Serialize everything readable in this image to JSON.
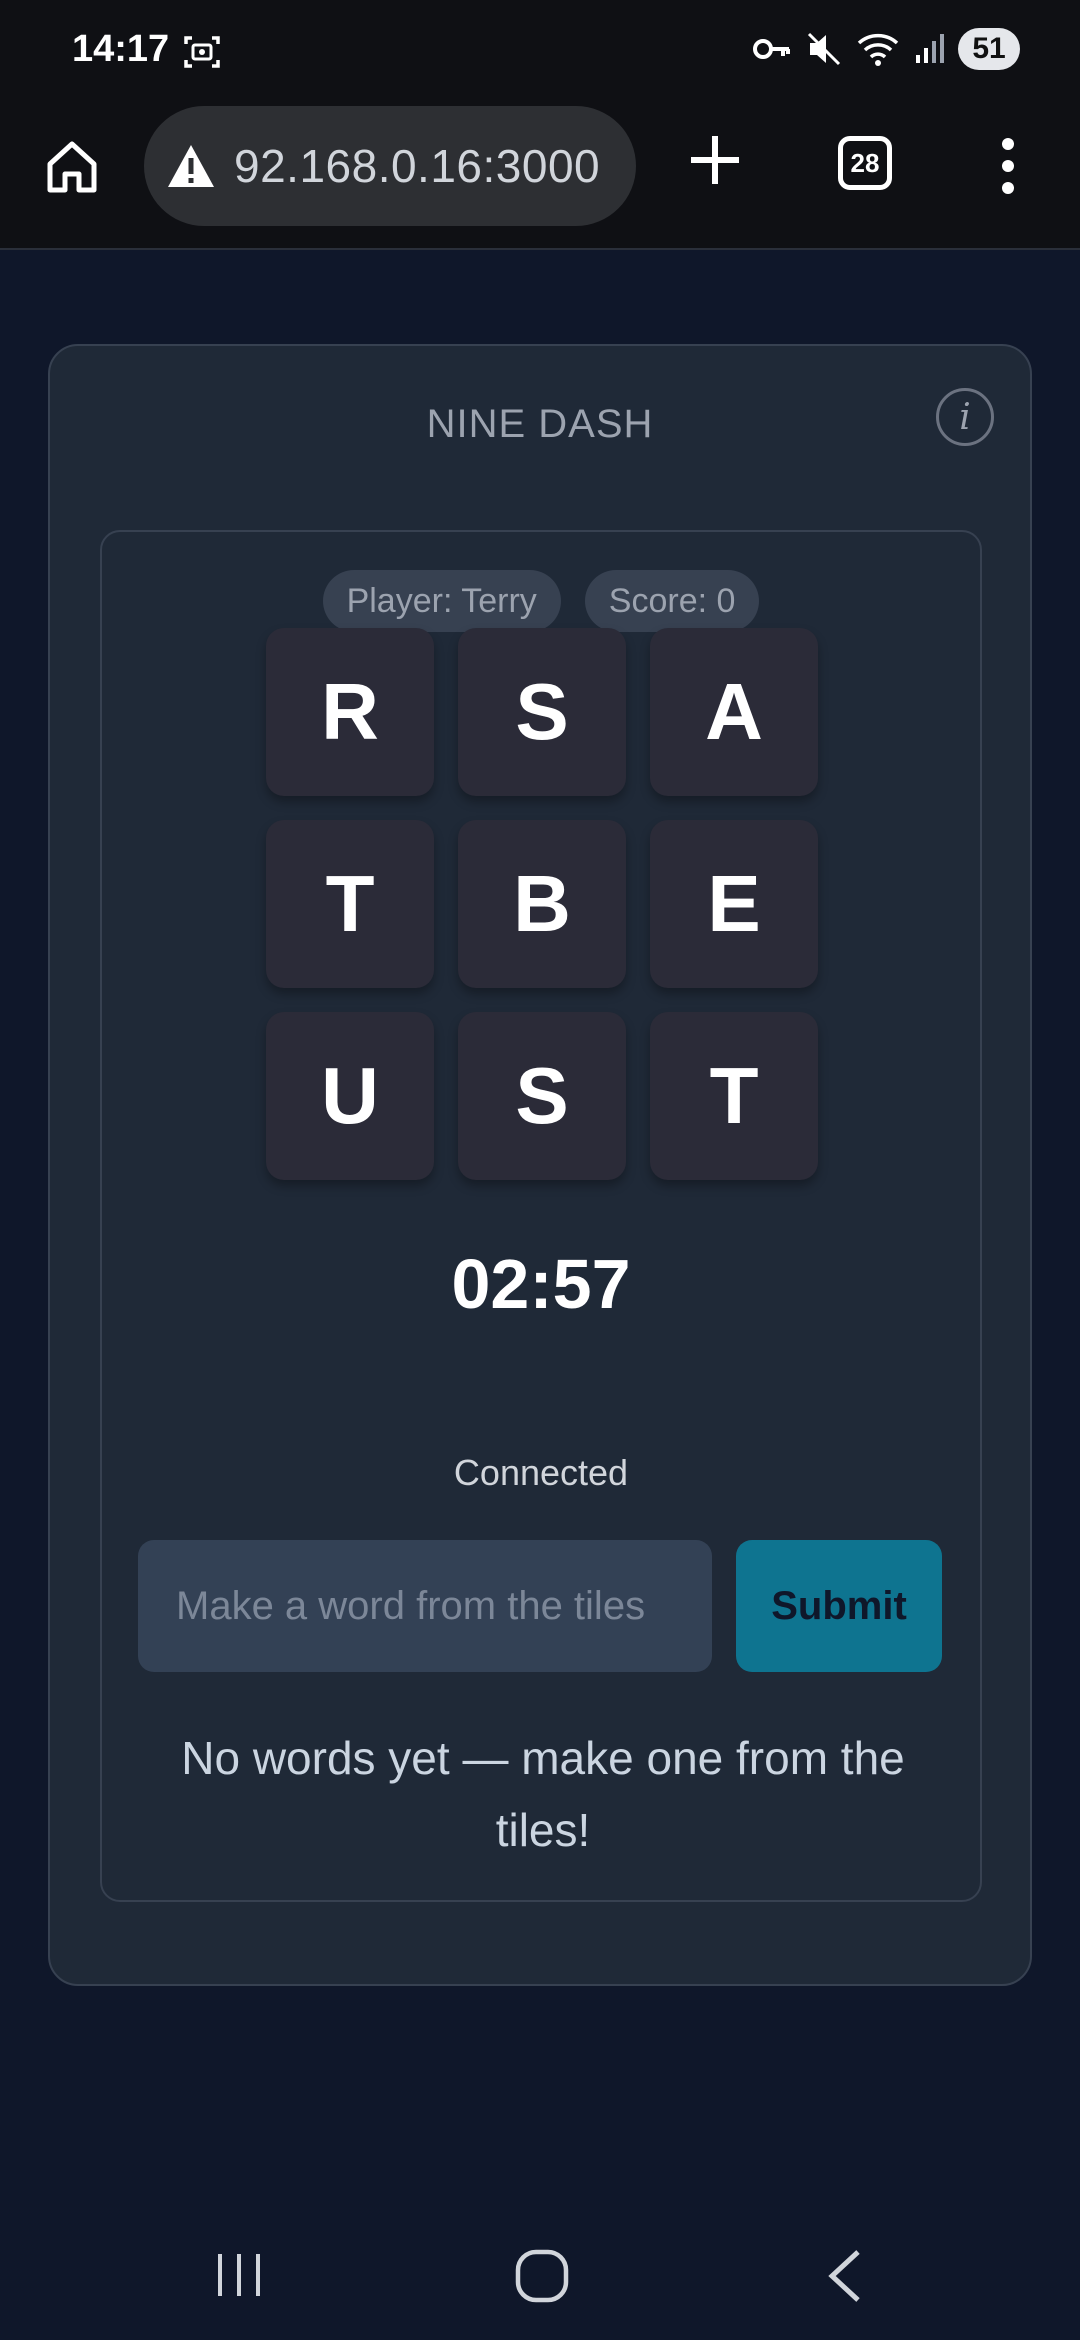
{
  "status_bar": {
    "time": "14:17",
    "battery": "51",
    "icons": [
      "screenshot-icon",
      "vpn-key-icon",
      "mute-icon",
      "wifi-icon",
      "signal-icon"
    ]
  },
  "browser": {
    "url": "92.168.0.16:3000",
    "tab_count": "28",
    "icons": [
      "home-icon",
      "warning-icon",
      "plus-icon",
      "tabs-icon",
      "more-vert-icon"
    ]
  },
  "game": {
    "title": "NINE DASH",
    "info_label": "i",
    "player": "Player: Terry",
    "score": "Score: 0",
    "tiles": [
      "R",
      "S",
      "A",
      "T",
      "B",
      "E",
      "U",
      "S",
      "T"
    ],
    "timer": "02:57",
    "connection": "Connected",
    "input": {
      "placeholder": "Make a word from the tiles",
      "value": ""
    },
    "submit_label": "Submit",
    "empty_message": "No words yet — make one from the tiles!"
  },
  "colors": {
    "background": "#0f172a",
    "card": "#1f2937",
    "tile": "#2b2b38",
    "accent": "#0e7490"
  }
}
